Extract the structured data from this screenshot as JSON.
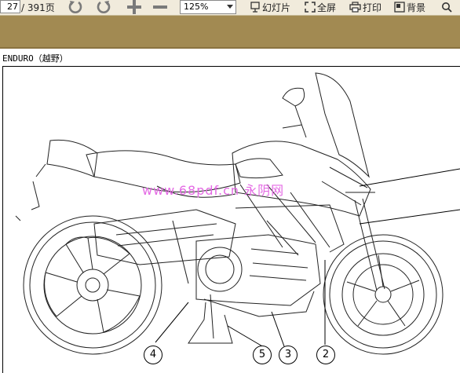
{
  "viewer": {
    "page_current": "27",
    "page_total": "/ 391页",
    "zoom": "125%",
    "buttons": {
      "slideshow": "幻灯片",
      "fullscreen": "全屏",
      "print": "打印",
      "background": "背景"
    }
  },
  "document": {
    "caption": "ENDURO（越野）",
    "watermark": "www.68pdf.cn 永阴网",
    "callouts": [
      "4",
      "5",
      "3",
      "2"
    ]
  },
  "colors": {
    "toolbar_bg": "#f1ebdc",
    "band": "#a28a52",
    "watermark": "#e46ae4"
  }
}
